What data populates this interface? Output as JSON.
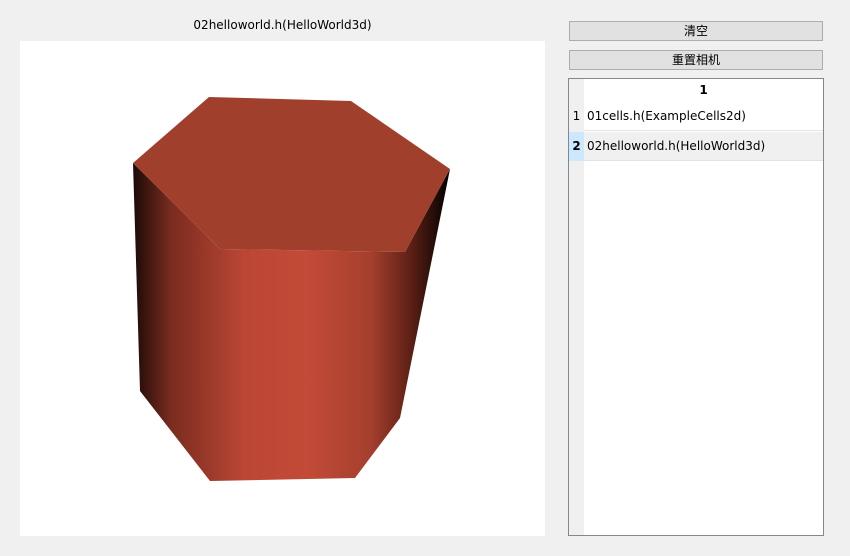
{
  "viewport": {
    "title": "02helloworld.h(HelloWorld3d)",
    "background": "#ffffff",
    "object": "hexagonal-prism",
    "object_color": "#c04a35"
  },
  "controls": {
    "clear_label": "清空",
    "reset_camera_label": "重置相机"
  },
  "table": {
    "column_header": "1",
    "rows": [
      {
        "num": "1",
        "text": "01cells.h(ExampleCells2d)"
      },
      {
        "num": "2",
        "text": "02helloworld.h(HelloWorld3d)",
        "selected": true
      }
    ]
  }
}
